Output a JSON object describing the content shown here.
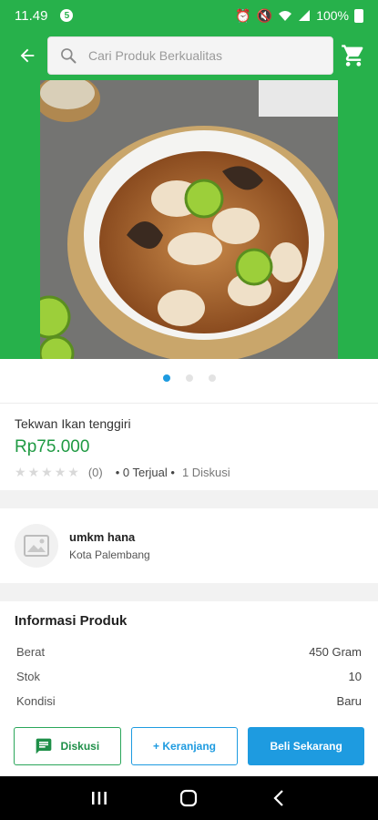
{
  "status_bar": {
    "time": "11.49",
    "notif_badge": "5",
    "battery": "100%"
  },
  "top_bar": {
    "search_placeholder": "Cari Produk Berkualitas"
  },
  "carousel": {
    "total_slides": 3,
    "active_slide": 1
  },
  "product": {
    "name": "Tekwan Ikan tenggiri",
    "price": "Rp75.000",
    "rating_count": "(0)",
    "sold": "• 0 Terjual •",
    "discussion": "1 Diskusi"
  },
  "seller": {
    "name": "umkm hana",
    "city": "Kota Palembang"
  },
  "info": {
    "title": "Informasi Produk",
    "rows": [
      {
        "label": "Berat",
        "value": "450 Gram"
      },
      {
        "label": "Stok",
        "value": "10"
      },
      {
        "label": "Kondisi",
        "value": "Baru"
      }
    ]
  },
  "actions": {
    "diskusi_label": "Diskusi",
    "keranjang_label": "+ Keranjang",
    "beli_label": "Beli Sekarang"
  },
  "colors": {
    "brand_green": "#27b14b",
    "price_green": "#1f9a43",
    "accent_blue": "#1e9be0"
  }
}
